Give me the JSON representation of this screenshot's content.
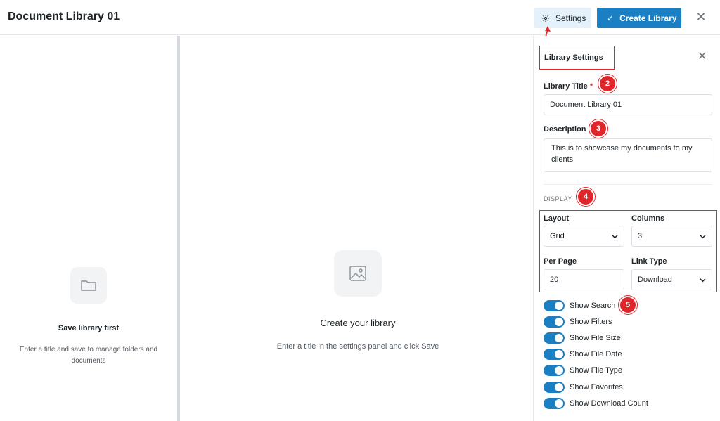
{
  "header": {
    "title": "Document Library 01",
    "settings_label": "Settings",
    "create_label": "Create Library",
    "close_glyph": "✕"
  },
  "left_pane": {
    "heading": "Save library first",
    "subtext": "Enter a title and save to manage folders and documents",
    "icon": "folder-icon"
  },
  "center_pane": {
    "heading": "Create your library",
    "subtext": "Enter a title in the settings panel and click Save",
    "icon": "image-icon"
  },
  "panel": {
    "title": "Library Settings",
    "close_glyph": "✕",
    "library_title": {
      "label": "Library Title",
      "required_mark": "*",
      "value": "Document Library 01"
    },
    "description": {
      "label": "Description",
      "value": "This is to showcase my documents to my clients"
    },
    "display_section": "DISPLAY",
    "layout": {
      "label": "Layout",
      "value": "Grid"
    },
    "columns": {
      "label": "Columns",
      "value": "3"
    },
    "per_page": {
      "label": "Per Page",
      "value": "20"
    },
    "link_type": {
      "label": "Link Type",
      "value": "Download"
    },
    "toggles": [
      {
        "label": "Show Search",
        "on": true
      },
      {
        "label": "Show Filters",
        "on": true
      },
      {
        "label": "Show File Size",
        "on": true
      },
      {
        "label": "Show File Date",
        "on": true
      },
      {
        "label": "Show File Type",
        "on": true
      },
      {
        "label": "Show Favorites",
        "on": true
      },
      {
        "label": "Show Download Count",
        "on": true
      }
    ]
  },
  "annotations": {
    "badge_2": "2",
    "badge_3": "3",
    "badge_4": "4",
    "badge_5": "5"
  },
  "colors": {
    "primary": "#1b7fc4",
    "settings_bg": "#e4f1fb",
    "annotation_red": "#e0262a"
  }
}
